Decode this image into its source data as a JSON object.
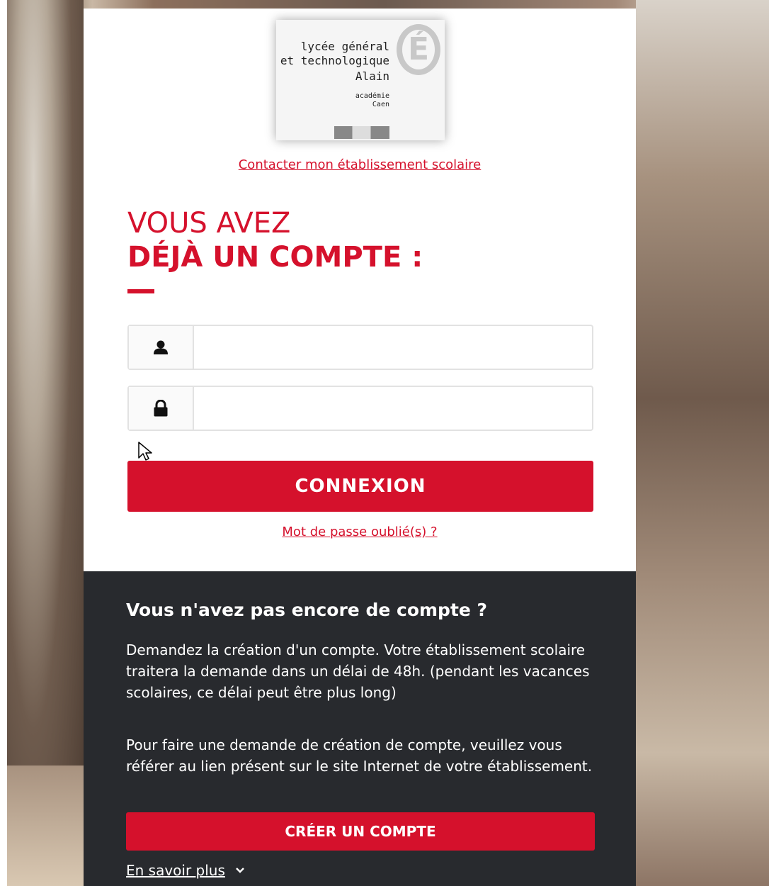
{
  "logo": {
    "line1": "lycée général",
    "line2": "et technologique",
    "line3": "Alain",
    "line4": "académie",
    "line5": "Caen",
    "mark": "É"
  },
  "contact_link": "Contacter mon établissement scolaire",
  "login": {
    "title_line1": "VOUS AVEZ",
    "title_line2": "DÉJÀ UN COMPTE :",
    "username_icon": "user-icon",
    "password_icon": "lock-icon",
    "username_value": "",
    "password_value": "",
    "submit_label": "CONNEXION",
    "forgot_link": "Mot de passe oublié(s) ?"
  },
  "signup": {
    "title": "Vous n'avez pas encore de compte ?",
    "text1": "Demandez la création d'un compte. Votre établissement scolaire traitera la demande dans un délai de 48h. (pendant les vacances scolaires, ce délai peut être plus long)",
    "text2": "Pour faire une demande de création de compte, veuillez vous référer au lien présent sur le site Internet de votre établissement.",
    "button_label": "CRÉER UN COMPTE",
    "more_link": "En savoir plus",
    "more_icon": "chevron-down-icon"
  },
  "colors": {
    "brand_red": "#d5112c",
    "dark_panel": "#282a2e"
  }
}
